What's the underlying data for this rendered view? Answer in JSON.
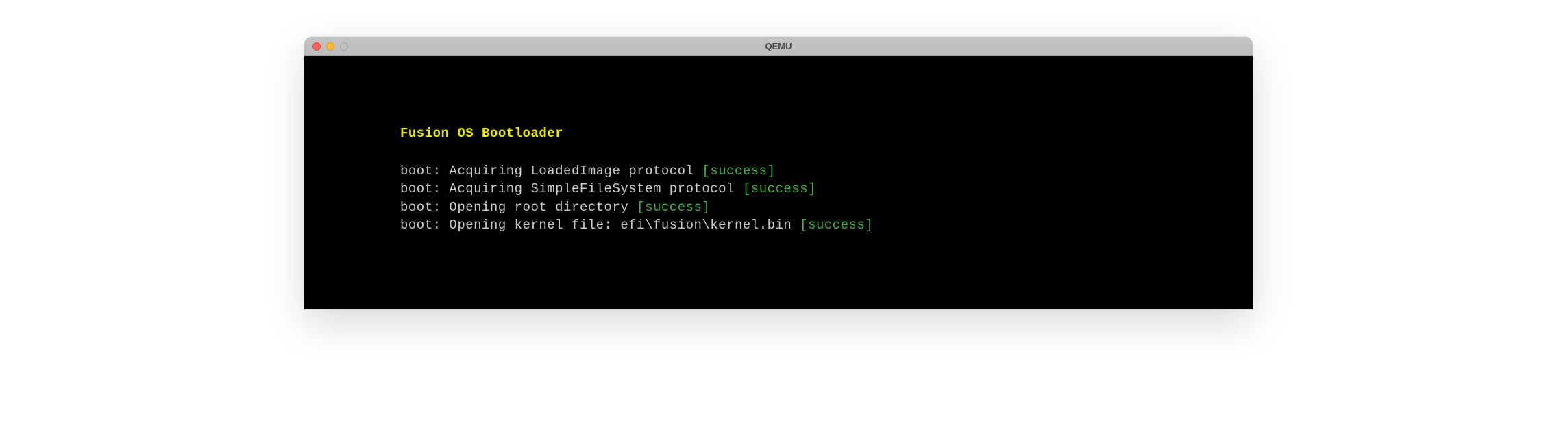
{
  "window": {
    "title": "QEMU"
  },
  "terminal": {
    "bootloader_title": "Fusion OS Bootloader",
    "lines": [
      {
        "prefix": "boot: ",
        "message": "Acquiring LoadedImage protocol ",
        "status": "[success]"
      },
      {
        "prefix": "boot: ",
        "message": "Acquiring SimpleFileSystem protocol ",
        "status": "[success]"
      },
      {
        "prefix": "boot: ",
        "message": "Opening root directory ",
        "status": "[success]"
      },
      {
        "prefix": "boot: ",
        "message": "Opening kernel file: efi\\fusion\\kernel.bin ",
        "status": "[success]"
      }
    ]
  }
}
